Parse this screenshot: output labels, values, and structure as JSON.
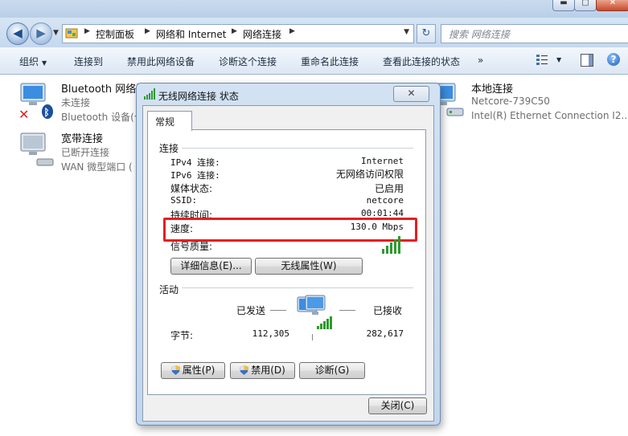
{
  "address": {
    "crumbs": [
      "控制面板",
      "网络和 Internet",
      "网络连接"
    ],
    "search_placeholder": "搜索 网络连接"
  },
  "toolbar": {
    "organize": "组织",
    "connect_to": "连接到",
    "disable": "禁用此网络设备",
    "diagnose": "诊断这个连接",
    "rename": "重命名此连接",
    "view_status": "查看此连接的状态",
    "more": "»"
  },
  "connections": [
    {
      "name": "Bluetooth 网络连",
      "status": "未连接",
      "device": "Bluetooth 设备(个"
    },
    {
      "name": "宽带连接",
      "status": "已断开连接",
      "device": "WAN 微型端口 ("
    },
    {
      "name": "本地连接",
      "status": "Netcore-739C50",
      "device": "Intel(R) Ethernet Connection I2..."
    }
  ],
  "dialog": {
    "title": "无线网络连接 状态",
    "close_glyph": "✕",
    "tab": "常规",
    "connection_section": "连接",
    "fields": [
      {
        "label": "IPv4 连接:",
        "value": "Internet"
      },
      {
        "label": "IPv6 连接:",
        "value": "无网络访问权限"
      },
      {
        "label": "媒体状态:",
        "value": "已启用"
      },
      {
        "label": "SSID:",
        "value": "netcore"
      },
      {
        "label": "持续时间:",
        "value": "00:01:44"
      },
      {
        "label": "速度:",
        "value": "130.0 Mbps"
      }
    ],
    "signal_label": "信号质量:",
    "signal_bars": 5,
    "details_button": "详细信息(E)...",
    "wireless_props_button": "无线属性(W)",
    "activity_section": "活动",
    "sent_label": "已发送",
    "received_label": "已接收",
    "bytes_label": "字节:",
    "bytes_sent": "112,305",
    "bytes_received": "282,617",
    "properties_button": "属性(P)",
    "disable_button": "禁用(D)",
    "diagnose_button": "诊断(G)",
    "close_button": "关闭(C)"
  },
  "colors": {
    "highlight": "#e51f1f",
    "signal": "#2e9b2e"
  }
}
